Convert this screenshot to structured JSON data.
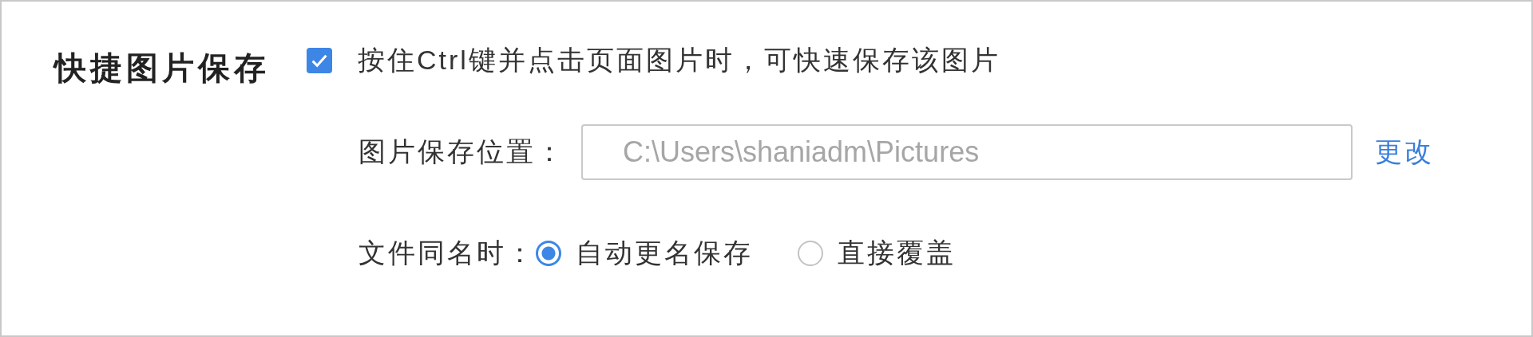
{
  "section": {
    "title": "快捷图片保存"
  },
  "quick_save": {
    "checked": true,
    "label": "按住Ctrl键并点击页面图片时，可快速保存该图片"
  },
  "save_location": {
    "label": "图片保存位置：",
    "value": "C:\\Users\\shaniadm\\Pictures",
    "link": "更改"
  },
  "duplicate_name": {
    "label": "文件同名时：",
    "options": [
      {
        "label": "自动更名保存",
        "selected": true
      },
      {
        "label": "直接覆盖",
        "selected": false
      }
    ]
  }
}
